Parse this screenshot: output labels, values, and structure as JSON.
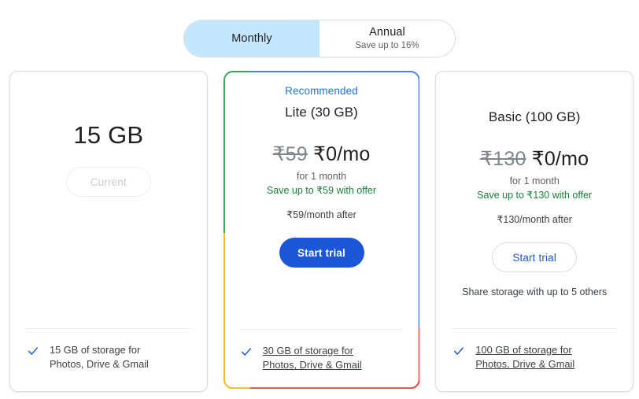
{
  "billing_toggle": {
    "options": [
      {
        "label": "Monthly",
        "sub": "",
        "active": true
      },
      {
        "label": "Annual",
        "sub": "Save up to 16%",
        "active": false
      }
    ]
  },
  "colors": {
    "accent_blue": "#1a73e8",
    "button_blue": "#1a56d6",
    "save_green": "#188038",
    "toggle_active_bg": "#c2e7ff",
    "border_green": "#34a853",
    "border_yellow": "#fbbc04",
    "border_red": "#ea4335"
  },
  "cards": [
    {
      "recommended_label": "",
      "plan_name": "",
      "big_storage": "15 GB",
      "price_old": "",
      "price_new": "",
      "price_term": "",
      "price_save": "",
      "price_after": "",
      "button_label": "Current",
      "share_note": "",
      "feature_line1": "15 GB of storage for",
      "feature_line2": "Photos, Drive & Gmail",
      "check_icon": "check-icon"
    },
    {
      "recommended_label": "Recommended",
      "plan_name": "Lite (30 GB)",
      "big_storage": "",
      "price_old": "₹59",
      "price_new": "₹0/mo",
      "price_term": "for 1 month",
      "price_save": "Save up to ₹59 with offer",
      "price_after": "₹59/month after",
      "button_label": "Start trial",
      "share_note": "",
      "feature_line1": "30 GB of storage for",
      "feature_line2": "Photos, Drive & Gmail",
      "check_icon": "check-icon"
    },
    {
      "recommended_label": "",
      "plan_name": "Basic (100 GB)",
      "big_storage": "",
      "price_old": "₹130",
      "price_new": "₹0/mo",
      "price_term": "for 1 month",
      "price_save": "Save up to ₹130 with offer",
      "price_after": "₹130/month after",
      "button_label": "Start trial",
      "share_note": "Share storage with up to 5 others",
      "feature_line1": "100 GB of storage for",
      "feature_line2": "Photos, Drive & Gmail",
      "check_icon": "check-icon"
    }
  ]
}
